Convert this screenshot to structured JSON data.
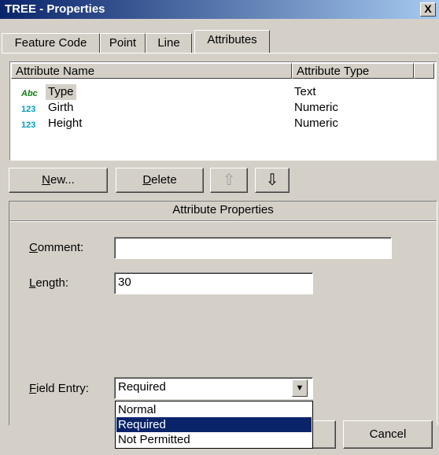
{
  "window": {
    "title": "TREE - Properties",
    "close_glyph": "X"
  },
  "tabs": [
    {
      "label": "Feature Code",
      "active": false
    },
    {
      "label": "Point",
      "active": false
    },
    {
      "label": "Line",
      "active": false
    },
    {
      "label": "Attributes",
      "active": true
    }
  ],
  "attributes_list": {
    "columns": [
      "Attribute Name",
      "Attribute Type"
    ],
    "rows": [
      {
        "icon": "abc-text-icon",
        "icon_text": "Abc",
        "name": "Type",
        "type": "Text",
        "selected": true
      },
      {
        "icon": "numeric-123-icon",
        "icon_text": "123",
        "name": "Girth",
        "type": "Numeric",
        "selected": false
      },
      {
        "icon": "numeric-123-icon",
        "icon_text": "123",
        "name": "Height",
        "type": "Numeric",
        "selected": false
      }
    ]
  },
  "buttons": {
    "new_label_u": "N",
    "new_label_rest": "ew...",
    "delete_label_u": "D",
    "delete_label_rest": "elete",
    "up_glyph": "⇧",
    "down_glyph": "⇩"
  },
  "attribute_properties": {
    "title": "Attribute Properties",
    "comment_label_u": "C",
    "comment_label_rest": "omment:",
    "comment_value": "",
    "length_label_u": "L",
    "length_label_rest": "ength:",
    "length_value": "30",
    "field_entry_label_u": "F",
    "field_entry_label_rest": "ield Entry:",
    "field_entry_value": "Required",
    "field_entry_options": [
      "Normal",
      "Required",
      "Not Permitted"
    ],
    "field_entry_selected": "Required"
  },
  "footer": {
    "cancel_label": "Cancel"
  },
  "colors": {
    "title_bar": "#0a246a",
    "selection": "#0a246a",
    "face": "#d4d0c8"
  }
}
